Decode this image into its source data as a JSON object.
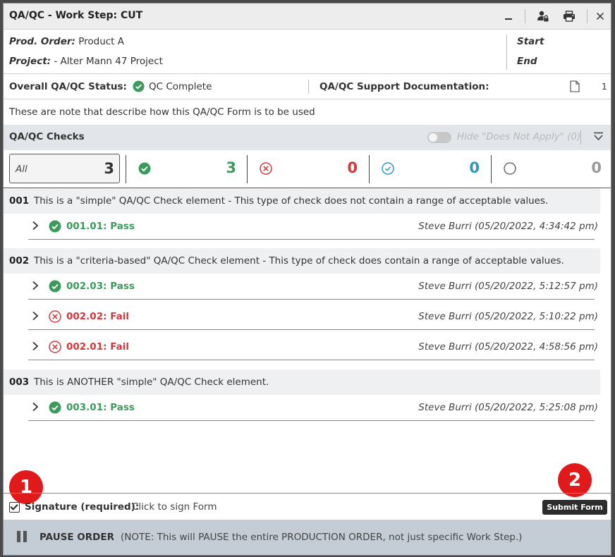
{
  "window": {
    "title": "QA/QC - Work Step: CUT",
    "icons": [
      "minimize-icon",
      "user-lock-icon",
      "print-icon",
      "close-icon"
    ]
  },
  "header": {
    "prod_order_label": "Prod. Order:",
    "prod_order_value": "Product A",
    "project_label": "Project:",
    "project_value": "- Alter Mann 47 Project",
    "start_label": "Start",
    "end_label": "End"
  },
  "status": {
    "overall_label": "Overall QA/QC Status:",
    "overall_value": "QC Complete",
    "support_label": "QA/QC Support Documentation:",
    "support_count": "1"
  },
  "note": "These are note that describe how this QA/QC Form is to be used",
  "checks": {
    "title": "QA/QC Checks",
    "hide_label": "Hide \"Does Not Apply\" (0)",
    "hide_toggle_on": false
  },
  "filters": {
    "all_label": "All",
    "all_count": "3",
    "pass_count": "3",
    "fail_count": "0",
    "na_count": "0",
    "open_count": "0"
  },
  "groups": [
    {
      "id": "001",
      "text": "This is a \"simple\" QA/QC Check element - This type of check does not contain a range of acceptable values.",
      "items": [
        {
          "status": "pass",
          "label": "001.01: Pass",
          "who": "Steve Burri (05/20/2022, 4:34:42 pm)"
        }
      ]
    },
    {
      "id": "002",
      "text": "This is a \"criteria-based\" QA/QC Check element - This type of check does contain a range of acceptable values.",
      "items": [
        {
          "status": "pass",
          "label": "002.03: Pass",
          "who": "Steve Burri (05/20/2022, 5:12:57 pm)"
        },
        {
          "status": "fail",
          "label": "002.02: Fail",
          "who": "Steve Burri (05/20/2022, 5:10:22 pm)"
        },
        {
          "status": "fail",
          "label": "002.01: Fail",
          "who": "Steve Burri (05/20/2022, 4:58:56 pm)"
        }
      ]
    },
    {
      "id": "003",
      "text": "This is ANOTHER \"simple\" QA/QC Check element.",
      "items": [
        {
          "status": "pass",
          "label": "003.01: Pass",
          "who": "Steve Burri (05/20/2022, 5:25:08 pm)"
        }
      ]
    }
  ],
  "callouts": [
    "1",
    "2"
  ],
  "signature": {
    "checked": true,
    "label": "Signature (required):",
    "value": "Click to sign Form"
  },
  "submit_label": "Submit Form",
  "pause": {
    "label": "PAUSE ORDER",
    "note": "(NOTE: This will PAUSE the entire PRODUCTION ORDER, not just specific Work Step.)"
  },
  "colors": {
    "pass": "#3c9b5b",
    "fail": "#d2383c",
    "na": "#2e97c6",
    "callout": "#e01a1a"
  }
}
